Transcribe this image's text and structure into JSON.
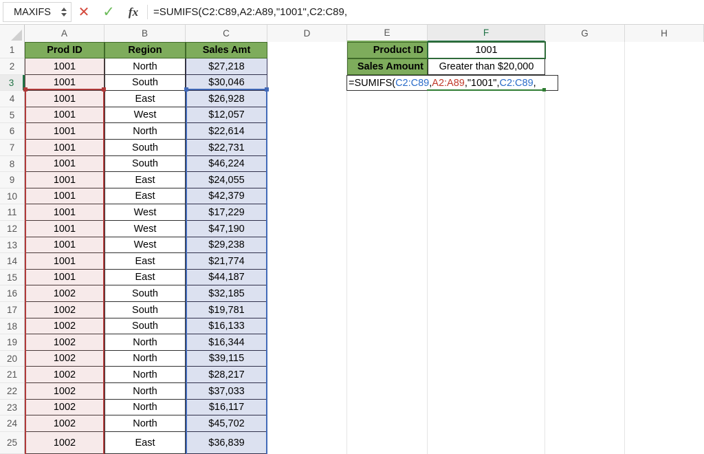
{
  "formula_bar": {
    "name_box_value": "MAXIFS",
    "cancel_icon": "cancel-x-icon",
    "enter_icon": "enter-check-icon",
    "fx_icon": "fx-icon",
    "formula_text": "=SUMIFS(C2:C89,A2:A89,\"1001\",C2:C89,"
  },
  "grid": {
    "column_headers": [
      "A",
      "B",
      "C",
      "D",
      "E",
      "F",
      "G",
      "H"
    ],
    "active_column": "F",
    "active_row": "3",
    "row_headers": [
      "1",
      "2",
      "3",
      "4",
      "5",
      "6",
      "7",
      "8",
      "9",
      "10",
      "11",
      "12",
      "13",
      "14",
      "15",
      "16",
      "17",
      "18",
      "19",
      "20",
      "21",
      "22",
      "23",
      "24",
      "25"
    ]
  },
  "table": {
    "headers": [
      "Prod ID",
      "Region",
      "Sales Amt"
    ],
    "rows": [
      {
        "row": "2",
        "prod_id": "1001",
        "region": "North",
        "sales": "$27,218"
      },
      {
        "row": "3",
        "prod_id": "1001",
        "region": "South",
        "sales": "$30,046"
      },
      {
        "row": "4",
        "prod_id": "1001",
        "region": "East",
        "sales": "$26,928"
      },
      {
        "row": "5",
        "prod_id": "1001",
        "region": "West",
        "sales": "$12,057"
      },
      {
        "row": "6",
        "prod_id": "1001",
        "region": "North",
        "sales": "$22,614"
      },
      {
        "row": "7",
        "prod_id": "1001",
        "region": "South",
        "sales": "$22,731"
      },
      {
        "row": "8",
        "prod_id": "1001",
        "region": "South",
        "sales": "$46,224"
      },
      {
        "row": "9",
        "prod_id": "1001",
        "region": "East",
        "sales": "$24,055"
      },
      {
        "row": "10",
        "prod_id": "1001",
        "region": "East",
        "sales": "$42,379"
      },
      {
        "row": "11",
        "prod_id": "1001",
        "region": "West",
        "sales": "$17,229"
      },
      {
        "row": "12",
        "prod_id": "1001",
        "region": "West",
        "sales": "$47,190"
      },
      {
        "row": "13",
        "prod_id": "1001",
        "region": "West",
        "sales": "$29,238"
      },
      {
        "row": "14",
        "prod_id": "1001",
        "region": "East",
        "sales": "$21,774"
      },
      {
        "row": "15",
        "prod_id": "1001",
        "region": "East",
        "sales": "$44,187"
      },
      {
        "row": "16",
        "prod_id": "1002",
        "region": "South",
        "sales": "$32,185"
      },
      {
        "row": "17",
        "prod_id": "1002",
        "region": "South",
        "sales": "$19,781"
      },
      {
        "row": "18",
        "prod_id": "1002",
        "region": "South",
        "sales": "$16,133"
      },
      {
        "row": "19",
        "prod_id": "1002",
        "region": "North",
        "sales": "$16,344"
      },
      {
        "row": "20",
        "prod_id": "1002",
        "region": "North",
        "sales": "$39,115"
      },
      {
        "row": "21",
        "prod_id": "1002",
        "region": "North",
        "sales": "$28,217"
      },
      {
        "row": "22",
        "prod_id": "1002",
        "region": "North",
        "sales": "$37,033"
      },
      {
        "row": "23",
        "prod_id": "1002",
        "region": "North",
        "sales": "$16,117"
      },
      {
        "row": "24",
        "prod_id": "1002",
        "region": "North",
        "sales": "$45,702"
      },
      {
        "row": "25",
        "prod_id": "1002",
        "region": "East",
        "sales": "$36,839"
      }
    ]
  },
  "criteria_panel": {
    "product_id_label": "Product ID",
    "product_id_value": "1001",
    "sales_amount_label": "Sales Amount",
    "sales_amount_value": "Greater than $20,000"
  },
  "edit_formula": {
    "prefix": "=SUMIFS(",
    "arg1": "C2:C89",
    "sep1": ",",
    "arg2": "A2:A89",
    "sep2": ",",
    "arg3": "\"1001\"",
    "sep3": ",",
    "arg4": "C2:C89",
    "sep4": ","
  },
  "colors": {
    "header_green": "#7eac5c",
    "pink_fill": "#f7eaea",
    "blue_fill": "#dce1f0",
    "range_red": "#b03a3a",
    "range_blue": "#4169b8",
    "excel_green": "#217346",
    "token_blue": "#2a6cc9",
    "token_red": "#c03a2b"
  }
}
